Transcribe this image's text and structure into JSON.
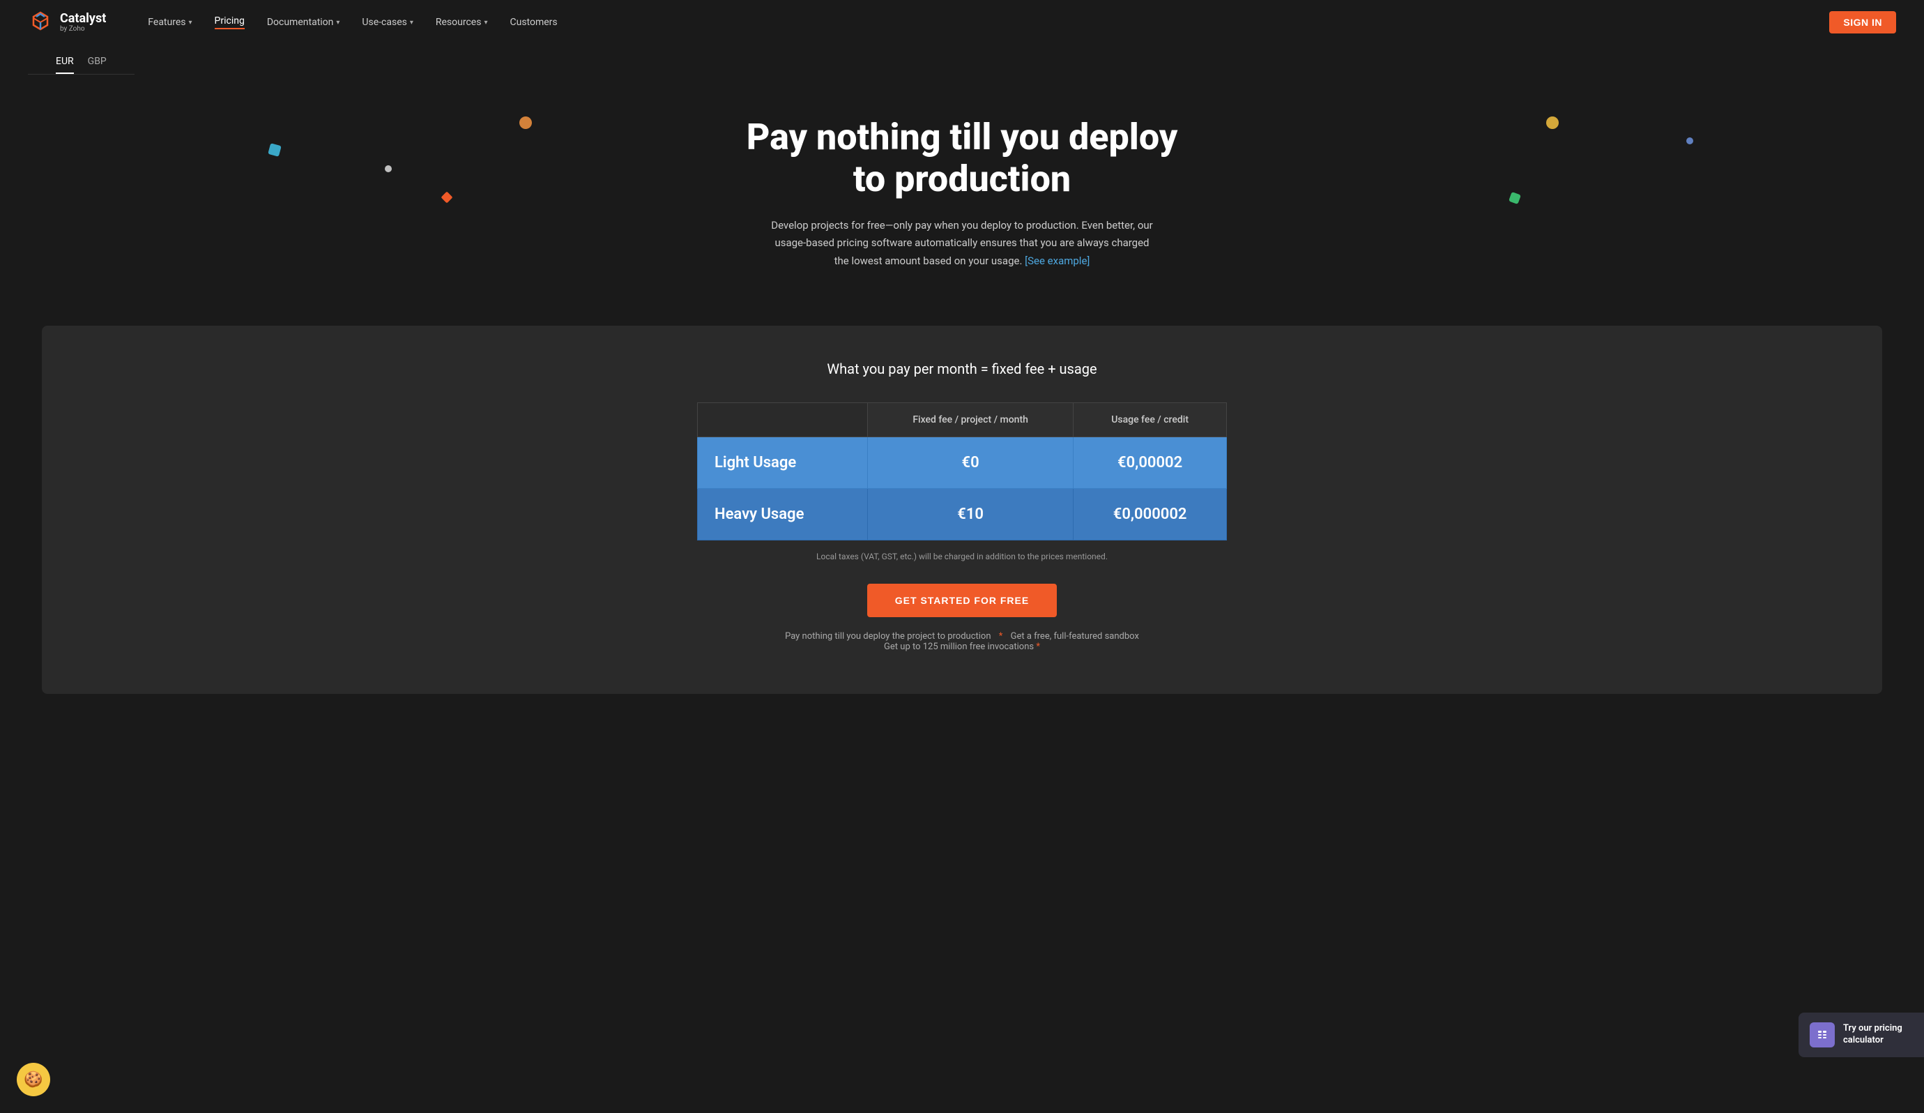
{
  "nav": {
    "logo_name": "Catalyst",
    "logo_sub": "by Zoho",
    "links": [
      {
        "label": "Features",
        "has_dropdown": true,
        "active": false
      },
      {
        "label": "Pricing",
        "has_dropdown": false,
        "active": true
      },
      {
        "label": "Documentation",
        "has_dropdown": true,
        "active": false
      },
      {
        "label": "Use-cases",
        "has_dropdown": true,
        "active": false
      },
      {
        "label": "Resources",
        "has_dropdown": true,
        "active": false
      },
      {
        "label": "Customers",
        "has_dropdown": false,
        "active": false
      }
    ],
    "signin_label": "SIGN IN"
  },
  "currency_tabs": [
    {
      "label": "EUR",
      "active": true
    },
    {
      "label": "GBP",
      "active": false
    }
  ],
  "hero": {
    "heading_line1": "Pay nothing till you deploy",
    "heading_line2": "to production",
    "description": "Develop projects for free—only pay when you deploy to production. Even better, our usage-based pricing software automatically ensures that you are always charged the lowest amount based on your usage.",
    "see_example_link": "[See example]"
  },
  "pricing_section": {
    "formula": "What you pay per month = fixed fee + usage",
    "table_headers": [
      "",
      "Fixed fee / project / month",
      "Usage fee / credit"
    ],
    "rows": [
      {
        "name": "Light Usage",
        "fixed_fee": "€0",
        "usage_fee": "€0,00002"
      },
      {
        "name": "Heavy Usage",
        "fixed_fee": "€10",
        "usage_fee": "€0,000002"
      }
    ],
    "tax_note": "Local taxes (VAT, GST, etc.) will be charged in addition to the prices mentioned.",
    "cta_button": "GET STARTED FOR FREE",
    "footer_note_1": "Pay nothing till you deploy the project to production",
    "footer_note_2": "Get a free, full-featured sandbox",
    "footer_note_3": "Get up to 125 million free invocations"
  },
  "calc_widget": {
    "label": "Try our pricing calculator",
    "icon": "▦"
  },
  "cookie": {
    "icon": "🍪"
  }
}
